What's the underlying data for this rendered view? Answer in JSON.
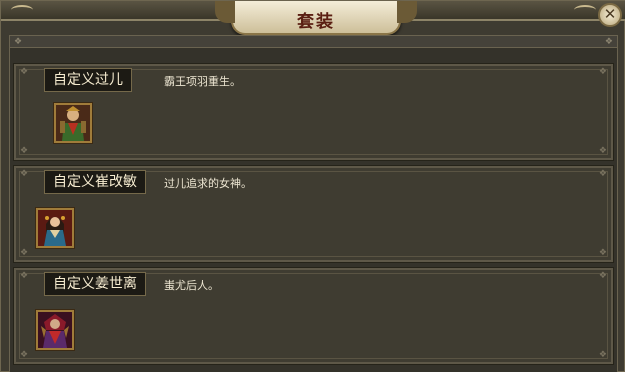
{
  "window": {
    "title": "套装",
    "close_label": "✕"
  },
  "sets": [
    {
      "name": "自定义过儿",
      "description": "霸王项羽重生。",
      "portrait": "warrior-portrait-icon"
    },
    {
      "name": "自定义崔改敏",
      "description": "过儿追求的女神。",
      "portrait": "heroine-portrait-icon"
    },
    {
      "name": "自定义姜世离",
      "description": "蚩尤后人。",
      "portrait": "demon-lord-portrait-icon"
    }
  ],
  "colors": {
    "accent": "#a07c3a",
    "panel": "#3f3c31",
    "title_text": "#5a1e12"
  }
}
